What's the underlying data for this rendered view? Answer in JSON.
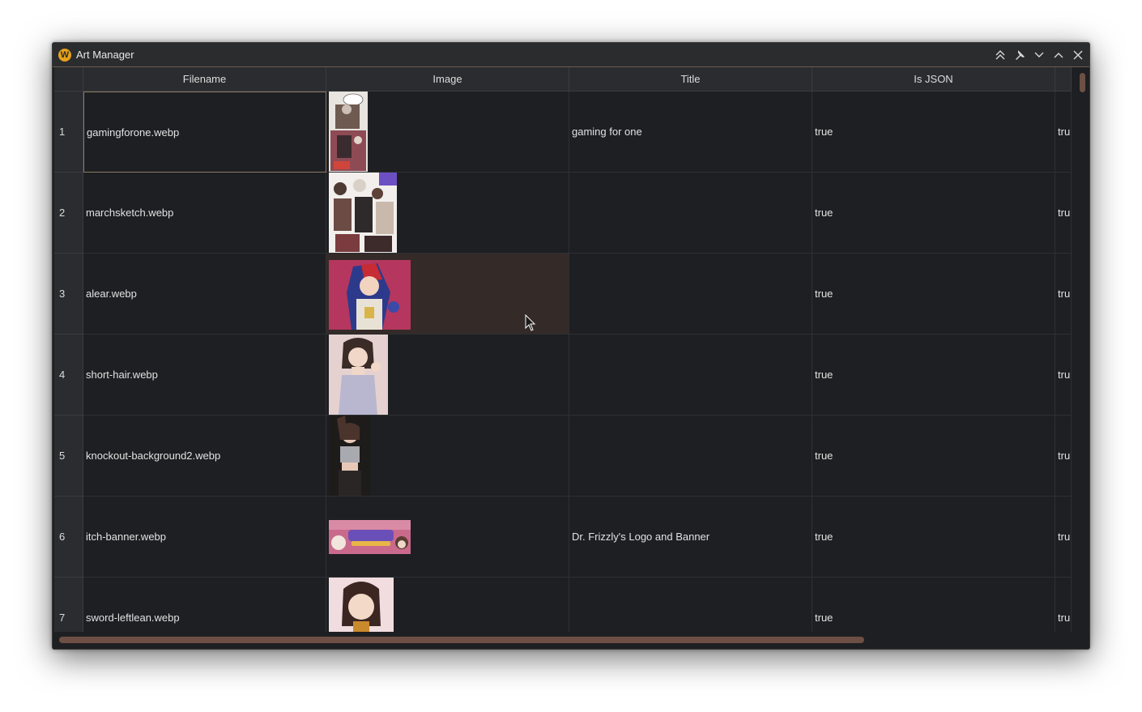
{
  "window": {
    "title": "Art Manager",
    "icon_letter": "W"
  },
  "titlebar_buttons": [
    "collapse-all-icon",
    "pin-icon",
    "chevron-down-icon",
    "chevron-up-icon",
    "close-icon"
  ],
  "columns": [
    "Filename",
    "Image",
    "Title",
    "Is JSON",
    ""
  ],
  "rows": [
    {
      "num": "1",
      "filename": "gamingforone.webp",
      "title": "gaming for one",
      "is_json": "true",
      "extra": "tru"
    },
    {
      "num": "2",
      "filename": "marchsketch.webp",
      "title": "",
      "is_json": "true",
      "extra": "tru"
    },
    {
      "num": "3",
      "filename": "alear.webp",
      "title": "",
      "is_json": "true",
      "extra": "tru"
    },
    {
      "num": "4",
      "filename": "short-hair.webp",
      "title": "",
      "is_json": "true",
      "extra": "tru"
    },
    {
      "num": "5",
      "filename": "knockout-background2.webp",
      "title": "",
      "is_json": "true",
      "extra": "tru"
    },
    {
      "num": "6",
      "filename": "itch-banner.webp",
      "title": "Dr. Frizzly's Logo and Banner",
      "is_json": "true",
      "extra": "tru"
    },
    {
      "num": "7",
      "filename": "sword-leftlean.webp",
      "title": "",
      "is_json": "true",
      "extra": "tru"
    }
  ],
  "colors": {
    "accent": "#6d4f45",
    "hover_row": "#342a28",
    "background": "#1d1f22",
    "header": "#2a2c2f"
  }
}
